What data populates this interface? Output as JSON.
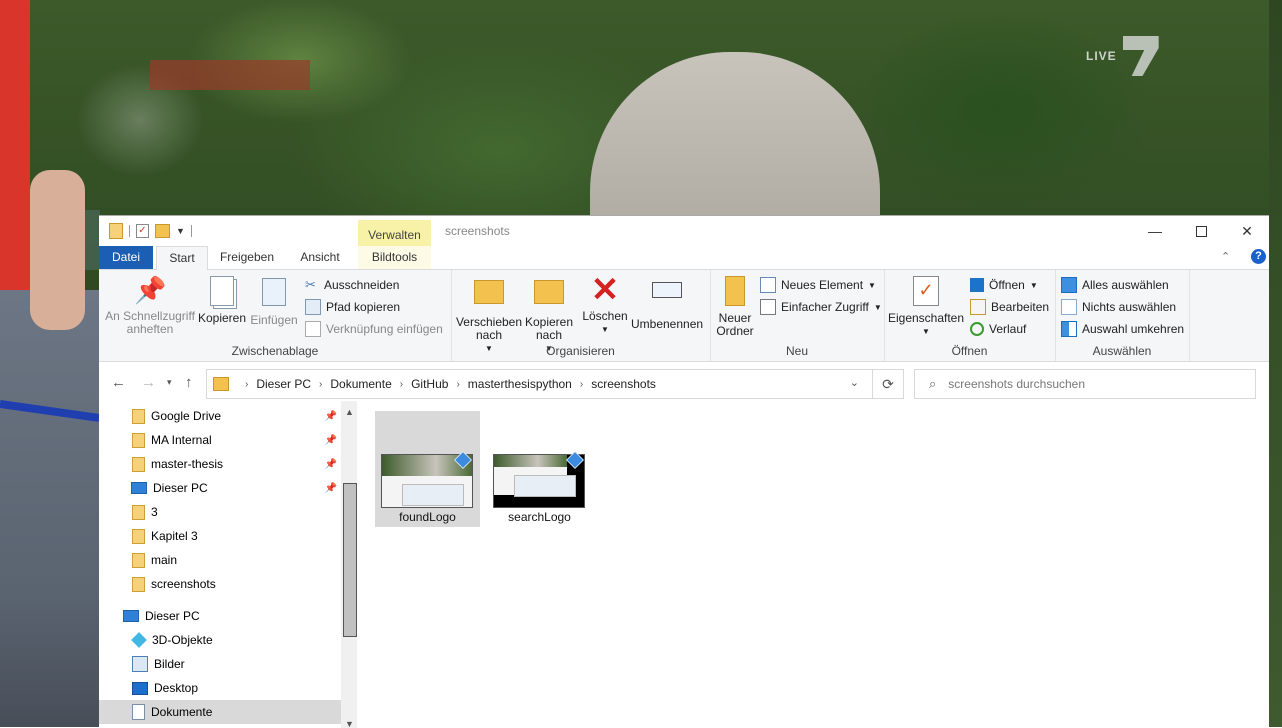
{
  "background": {
    "channel_logo_text": "LIVE"
  },
  "window": {
    "title": "screenshots",
    "context_tab_group": "Verwalten"
  },
  "tabs": [
    "Datei",
    "Start",
    "Freigeben",
    "Ansicht",
    "Bildtools"
  ],
  "ribbon": {
    "zwischenablage": {
      "label": "Zwischenablage",
      "pin": "An Schnellzugriff anheften",
      "copy": "Kopieren",
      "paste": "Einfügen",
      "cut": "Ausschneiden",
      "copy_path": "Pfad kopieren",
      "paste_link": "Verknüpfung einfügen"
    },
    "organisieren": {
      "label": "Organisieren",
      "move_to": "Verschieben nach",
      "copy_to": "Kopieren nach",
      "delete": "Löschen",
      "rename": "Umbenennen"
    },
    "neu": {
      "label": "Neu",
      "new_folder": "Neuer Ordner",
      "new_item": "Neues Element",
      "easy_access": "Einfacher Zugriff"
    },
    "oeffnen": {
      "label": "Öffnen",
      "properties": "Eigenschaften",
      "open": "Öffnen",
      "edit": "Bearbeiten",
      "history": "Verlauf"
    },
    "auswaehlen": {
      "label": "Auswählen",
      "select_all": "Alles auswählen",
      "select_none": "Nichts auswählen",
      "invert": "Auswahl umkehren"
    }
  },
  "address": {
    "breadcrumbs": [
      "Dieser PC",
      "Dokumente",
      "GitHub",
      "masterthesispython",
      "screenshots"
    ],
    "search_placeholder": "screenshots durchsuchen"
  },
  "nav": {
    "items": [
      {
        "label": "Google Drive",
        "pinned": true
      },
      {
        "label": "MA Internal",
        "pinned": true
      },
      {
        "label": "master-thesis",
        "pinned": true
      },
      {
        "label": "Dieser PC",
        "pinned": true
      },
      {
        "label": "3"
      },
      {
        "label": "Kapitel 3"
      },
      {
        "label": "main"
      },
      {
        "label": "screenshots"
      },
      {
        "label": "Dieser PC"
      },
      {
        "label": "3D-Objekte"
      },
      {
        "label": "Bilder"
      },
      {
        "label": "Desktop"
      },
      {
        "label": "Dokumente",
        "selected": true
      }
    ]
  },
  "files": [
    {
      "name": "foundLogo",
      "selected": true
    },
    {
      "name": "searchLogo",
      "selected": false
    }
  ]
}
